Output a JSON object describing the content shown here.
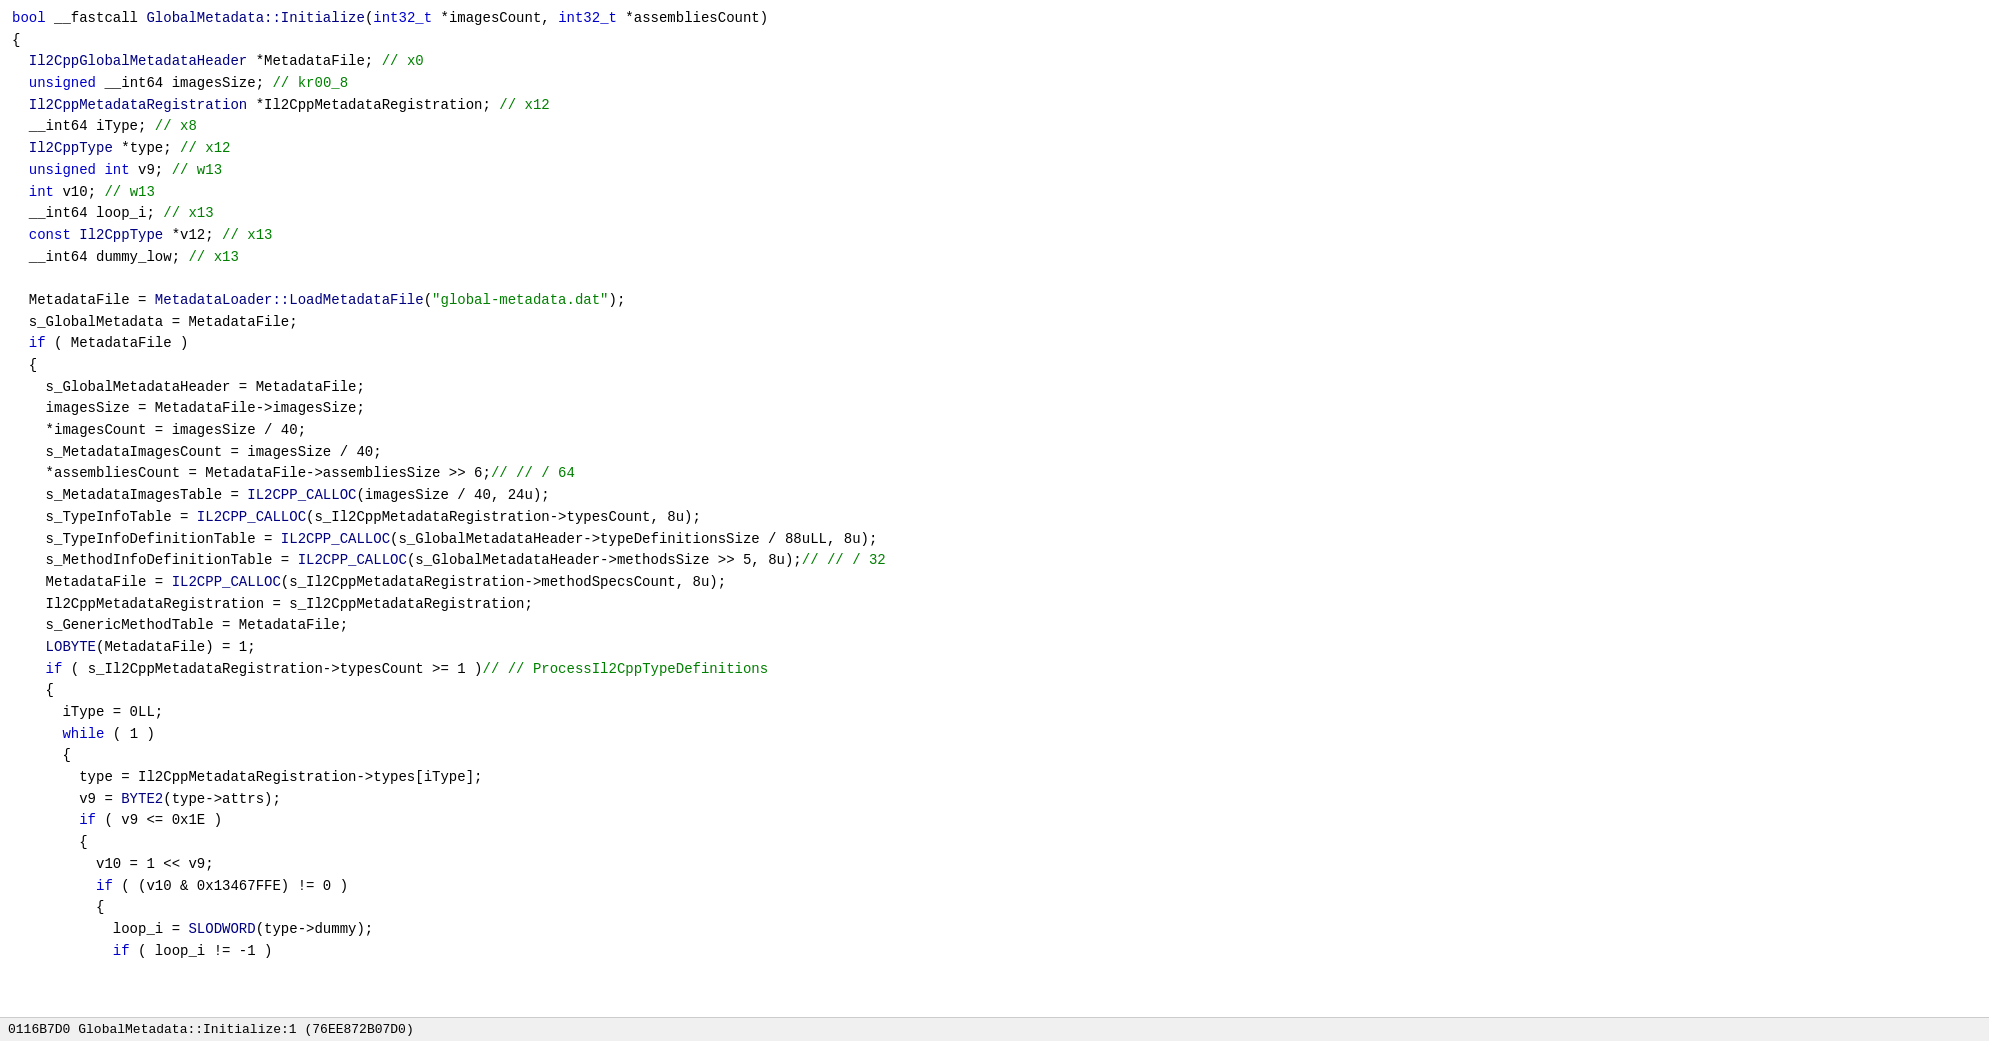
{
  "status_bar": {
    "address": "0116B7D0",
    "function": "GlobalMetadata::Initialize:1 (76EE872B07D0)"
  },
  "code": {
    "lines": [
      {
        "id": 1,
        "text": "bool __fastcall GlobalMetadata::Initialize(int32_t *imagesCount, int32_t *assembliesCount)"
      },
      {
        "id": 2,
        "text": "{"
      },
      {
        "id": 3,
        "text": "  Il2CppGlobalMetadataHeader *MetadataFile; // x0"
      },
      {
        "id": 4,
        "text": "  unsigned __int64 imagesSize; // kr00_8"
      },
      {
        "id": 5,
        "text": "  Il2CppMetadataRegistration *Il2CppMetadataRegistration; // x12"
      },
      {
        "id": 6,
        "text": "  __int64 iType; // x8"
      },
      {
        "id": 7,
        "text": "  Il2CppType *type; // x12"
      },
      {
        "id": 8,
        "text": "  unsigned int v9; // w13"
      },
      {
        "id": 9,
        "text": "  int v10; // w13"
      },
      {
        "id": 10,
        "text": "  __int64 loop_i; // x13"
      },
      {
        "id": 11,
        "text": "  const Il2CppType *v12; // x13"
      },
      {
        "id": 12,
        "text": "  __int64 dummy_low; // x13"
      },
      {
        "id": 13,
        "text": ""
      },
      {
        "id": 14,
        "text": "  MetadataFile = MetadataLoader::LoadMetadataFile(\"global-metadata.dat\");"
      },
      {
        "id": 15,
        "text": "  s_GlobalMetadata = MetadataFile;"
      },
      {
        "id": 16,
        "text": "  if ( MetadataFile )"
      },
      {
        "id": 17,
        "text": "  {"
      },
      {
        "id": 18,
        "text": "    s_GlobalMetadataHeader = MetadataFile;"
      },
      {
        "id": 19,
        "text": "    imagesSize = MetadataFile->imagesSize;"
      },
      {
        "id": 20,
        "text": "    *imagesCount = imagesSize / 40;"
      },
      {
        "id": 21,
        "text": "    s_MetadataImagesCount = imagesSize / 40;"
      },
      {
        "id": 22,
        "text": "    *assembliesCount = MetadataFile->assembliesSize >> 6;// // / 64"
      },
      {
        "id": 23,
        "text": "    s_MetadataImagesTable = IL2CPP_CALLOC(imagesSize / 40, 24u);"
      },
      {
        "id": 24,
        "text": "    s_TypeInfoTable = IL2CPP_CALLOC(s_Il2CppMetadataRegistration->typesCount, 8u);"
      },
      {
        "id": 25,
        "text": "    s_TypeInfoDefinitionTable = IL2CPP_CALLOC(s_GlobalMetadataHeader->typeDefinitionsSize / 88uLL, 8u);"
      },
      {
        "id": 26,
        "text": "    s_MethodInfoDefinitionTable = IL2CPP_CALLOC(s_GlobalMetadataHeader->methodsSize >> 5, 8u);// // / 32"
      },
      {
        "id": 27,
        "text": "    MetadataFile = IL2CPP_CALLOC(s_Il2CppMetadataRegistration->methodSpecsCount, 8u);"
      },
      {
        "id": 28,
        "text": "    Il2CppMetadataRegistration = s_Il2CppMetadataRegistration;"
      },
      {
        "id": 29,
        "text": "    s_GenericMethodTable = MetadataFile;"
      },
      {
        "id": 30,
        "text": "    LOBYTE(MetadataFile) = 1;"
      },
      {
        "id": 31,
        "text": "    if ( s_Il2CppMetadataRegistration->typesCount >= 1 )// // ProcessIl2CppTypeDefinitions"
      },
      {
        "id": 32,
        "text": "    {"
      },
      {
        "id": 33,
        "text": "      iType = 0LL;"
      },
      {
        "id": 34,
        "text": "      while ( 1 )"
      },
      {
        "id": 35,
        "text": "      {"
      },
      {
        "id": 36,
        "text": "        type = Il2CppMetadataRegistration->types[iType];"
      },
      {
        "id": 37,
        "text": "        v9 = BYTE2(type->attrs);"
      },
      {
        "id": 38,
        "text": "        if ( v9 <= 0x1E )"
      },
      {
        "id": 39,
        "text": "        {"
      },
      {
        "id": 40,
        "text": "          v10 = 1 << v9;"
      },
      {
        "id": 41,
        "text": "          if ( (v10 & 0x13467FFE) != 0 )"
      },
      {
        "id": 42,
        "text": "          {"
      },
      {
        "id": 43,
        "text": "            loop_i = SLODWORD(type->dummy);"
      },
      {
        "id": 44,
        "text": "            if ( loop_i != -1 )"
      }
    ]
  }
}
